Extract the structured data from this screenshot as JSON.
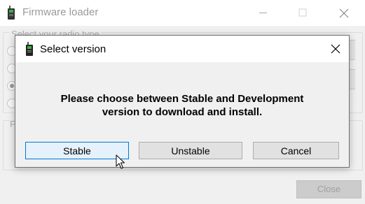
{
  "main_window": {
    "title": "Firmware loader",
    "group_label": "Select your radio type",
    "group2_label": "F",
    "close_button": "Close"
  },
  "dialog": {
    "title": "Select version",
    "message_line1": "Please choose between Stable and Development",
    "message_line2": "version to download and install.",
    "buttons": {
      "stable": "Stable",
      "unstable": "Unstable",
      "cancel": "Cancel"
    }
  },
  "icons": {
    "app": "radio-handset-icon",
    "minimize": "minimize-icon",
    "maximize": "maximize-icon",
    "close": "close-icon",
    "cursor": "mouse-pointer-icon"
  },
  "colors": {
    "focused_button_border": "#0078d7",
    "focused_button_fill": "#e5f1fb",
    "button_fill": "#e1e1e1"
  }
}
